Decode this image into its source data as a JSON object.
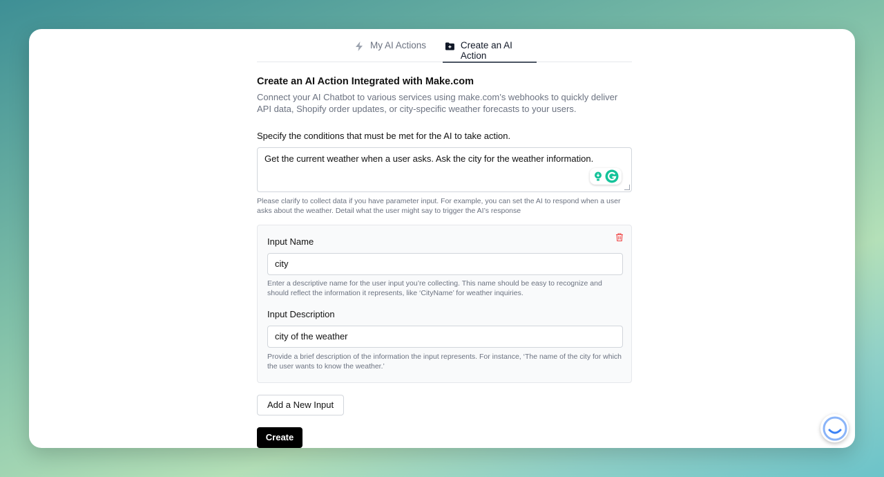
{
  "tabs": {
    "my_actions": "My AI Actions",
    "create_action": "Create an AI Action"
  },
  "header": {
    "title": "Create an AI Action Integrated with Make.com",
    "description": "Connect your AI Chatbot to various services using make.com’s webhooks to quickly deliver API data, Shopify order updates, or city-specific weather forecasts to your users."
  },
  "conditions": {
    "label": "Specify the conditions that must be met for the AI to take action.",
    "value": "Get the current weather when a user asks. Ask the city for the weather information.",
    "help": "Please clarify to collect data if you have parameter input. For example, you can set the AI to respond when a user asks about the weather. Detail what the user might say to trigger the AI’s response"
  },
  "input_panel": {
    "name_label": "Input Name",
    "name_value": "city",
    "name_help": "Enter a descriptive name for the user input you’re collecting. This name should be easy to recognize and should reflect the information it represents, like ‘CityName’ for weather inquiries.",
    "desc_label": "Input Description",
    "desc_value": "city of the weather",
    "desc_help": "Provide a brief description of the information the input represents. For instance, ‘The name of the city for which the user wants to know the weather.’"
  },
  "buttons": {
    "add_input": "Add a New Input",
    "create": "Create"
  },
  "colors": {
    "active_tab_underline": "#4b5563",
    "primary_button": "#000000",
    "delete_icon": "#ef4444",
    "grammarly_green": "#15c39a"
  }
}
